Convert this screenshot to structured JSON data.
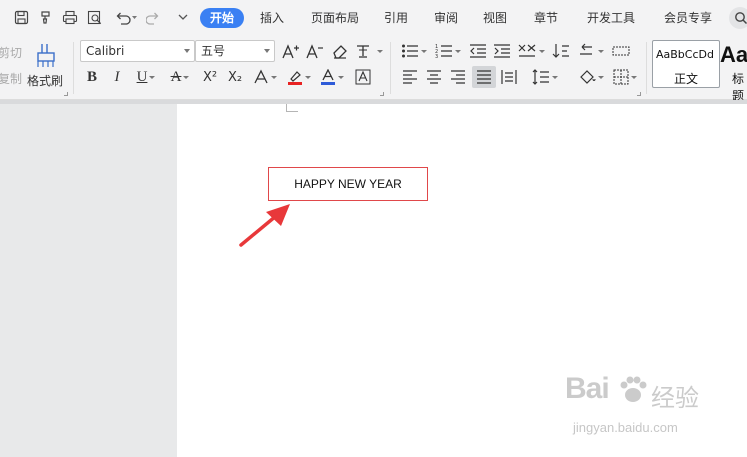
{
  "menu_tabs": [
    "开始",
    "插入",
    "页面布局",
    "引用",
    "审阅",
    "视图",
    "章节",
    "开发工具",
    "会员专享"
  ],
  "quick_access": [
    "save-icon",
    "format-painter-quick-icon",
    "print-icon",
    "print-preview-icon",
    "undo-icon",
    "redo-icon",
    "customize-dropdown-icon"
  ],
  "clipboard": {
    "cut_label": "剪切",
    "copy_label": "复制",
    "format_painter_label": "格式刷"
  },
  "font": {
    "name": "Calibri",
    "size": "五号"
  },
  "font_buttons": [
    "B",
    "I",
    "U",
    "A",
    "X²",
    "X₂",
    "A"
  ],
  "colors": {
    "accent": "#3a80f3",
    "highlight": "#e82222",
    "font_color": "#2e5bd8",
    "textbox_border": "#e0484a",
    "arrow": "#e8383a"
  },
  "styles": [
    {
      "sample": "AaBbCcDd",
      "name": "正文"
    },
    {
      "sample": "Aa",
      "name": "标题"
    }
  ],
  "document": {
    "textbox_text": "HAPPY NEW YEAR"
  },
  "watermark": {
    "logo": "Bai",
    "cn": "经验",
    "url": "jingyan.baidu.com"
  }
}
